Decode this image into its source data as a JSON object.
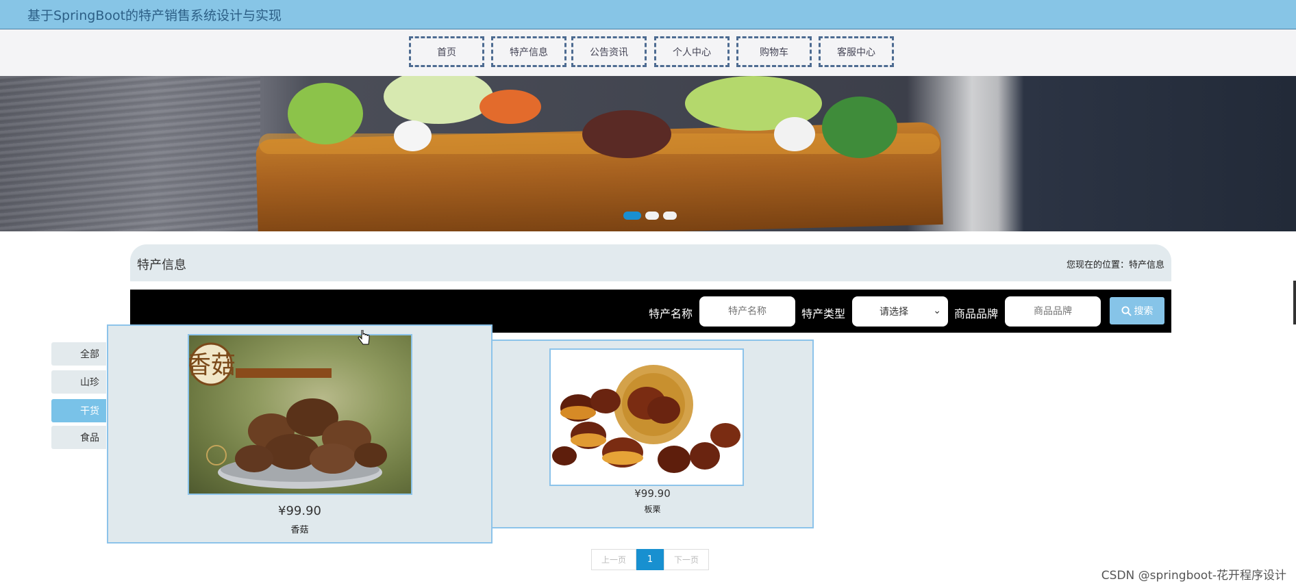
{
  "header": {
    "title": "基于SpringBoot的特产销售系统设计与实现"
  },
  "nav": {
    "items": [
      "首页",
      "特产信息",
      "公告资讯",
      "个人中心",
      "购物车",
      "客服中心"
    ]
  },
  "banner": {
    "slides": 3,
    "active_slide": 1
  },
  "section": {
    "title": "特产信息",
    "location_label": "您现在的位置：",
    "location_value": "特产信息"
  },
  "search": {
    "name_label": "特产名称",
    "name_placeholder": "特产名称",
    "type_label": "特产类型",
    "type_selected": "请选择",
    "brand_label": "商品品牌",
    "brand_placeholder": "商品品牌",
    "search_button": "搜索"
  },
  "categories": [
    {
      "label": "全部",
      "active": false
    },
    {
      "label": "山珍",
      "active": false
    },
    {
      "label": "干货",
      "active": true
    },
    {
      "label": "食品",
      "active": false
    }
  ],
  "products": [
    {
      "price": "¥99.90",
      "name": "香菇",
      "image_text": "香菇"
    },
    {
      "price": "¥99.90",
      "name": "板栗"
    }
  ],
  "pagination": {
    "prev": "上一页",
    "current": "1",
    "next": "下一页"
  },
  "watermark": "CSDN @springboot-花开程序设计",
  "colors": {
    "header_bg": "#87c5e6",
    "accent": "#1890d0",
    "card_border": "#8cc3ea",
    "category_active": "#79c2e8"
  }
}
